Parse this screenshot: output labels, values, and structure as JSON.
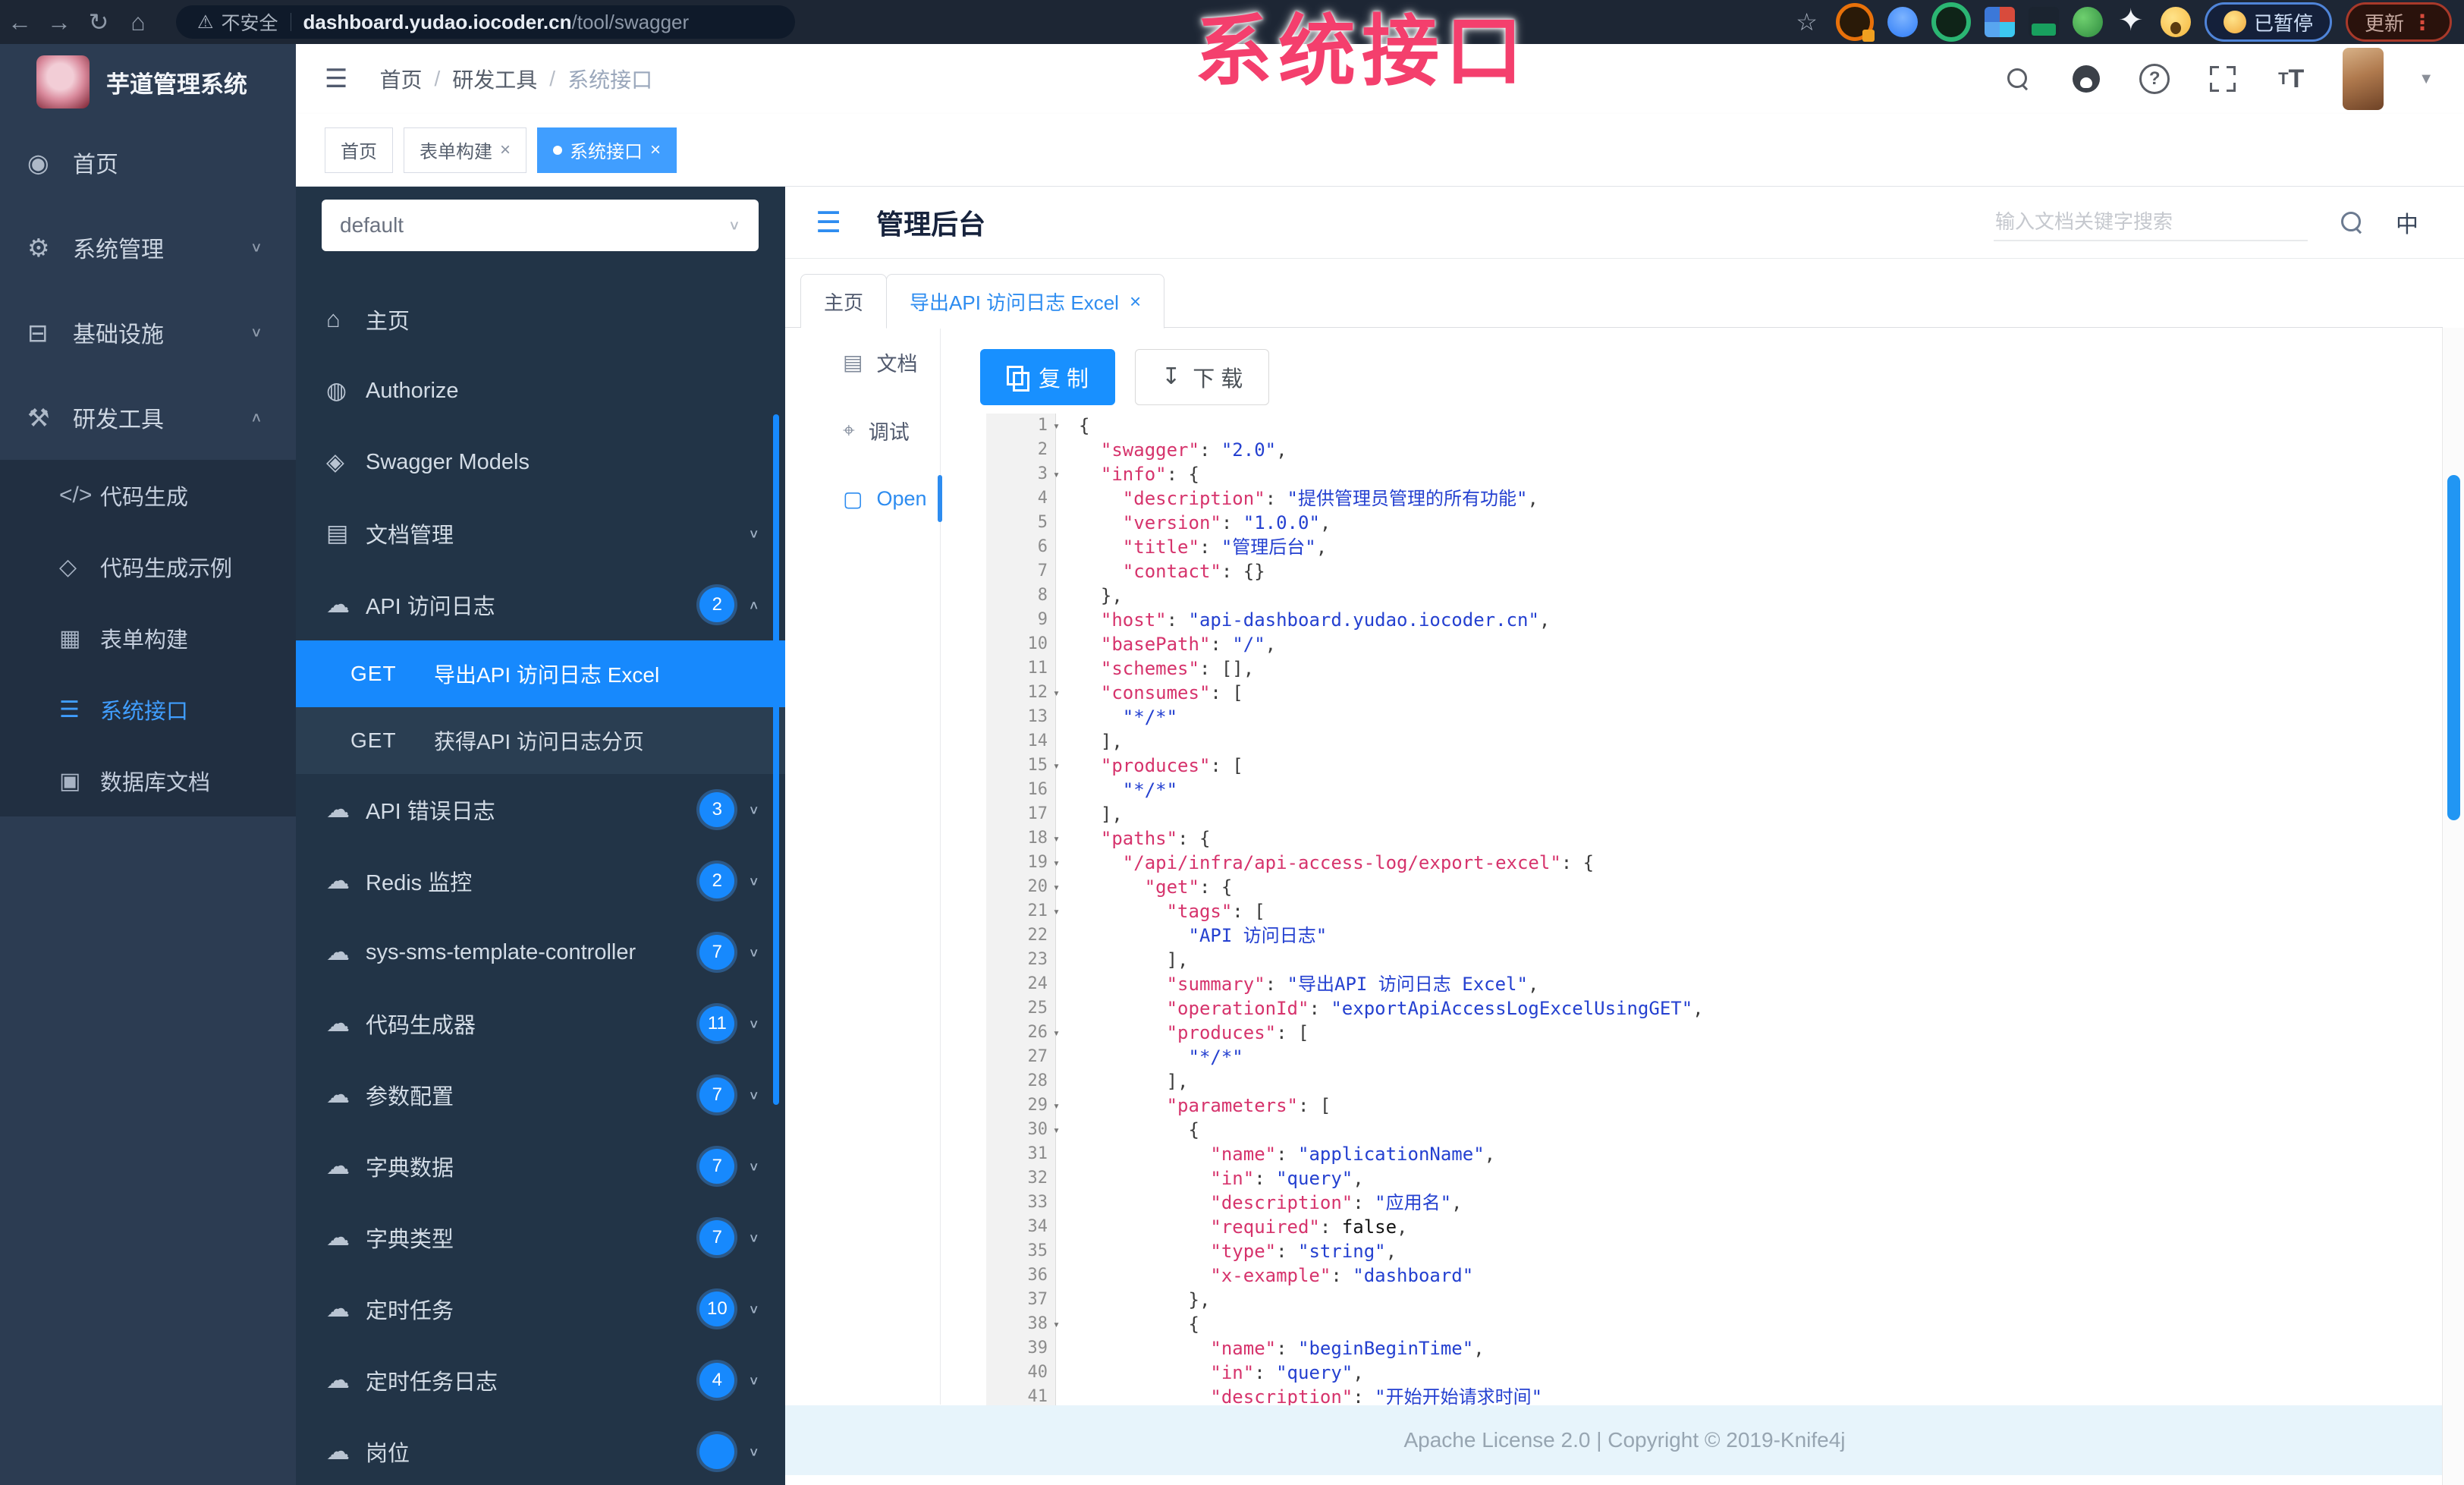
{
  "watermark": "系统接口",
  "browser": {
    "security_label": "不安全",
    "url_host": "dashboard.yudao.iocoder.cn",
    "url_path": "/tool/swagger",
    "nav_icons": [
      "back-icon",
      "forward-icon",
      "reload-icon",
      "home-icon"
    ],
    "nav_glyphs": [
      "←",
      "→",
      "↻",
      "⌂"
    ],
    "extensions": [
      "orange-extension-icon",
      "blue-drop-extension-icon",
      "green-ring-extension-icon",
      "grid-extension-icon",
      "dark-bottle-extension-icon",
      "green-leaf-extension-icon",
      "white-star-extension-icon",
      "emoji-extension-icon"
    ],
    "paused_label": "已暂停",
    "update_label": "更新"
  },
  "sidebar": {
    "logo_title": "芋道管理系统",
    "items": [
      {
        "label": "首页",
        "icon": "dashboard-icon",
        "glyph": "◉",
        "chevron": ""
      },
      {
        "label": "系统管理",
        "icon": "gear-icon",
        "glyph": "⚙",
        "chevron": "down"
      },
      {
        "label": "基础设施",
        "icon": "infrastructure-icon",
        "glyph": "⊟",
        "chevron": "down"
      },
      {
        "label": "研发工具",
        "icon": "tools-icon",
        "glyph": "⚒",
        "chevron": "up"
      }
    ],
    "submenu": [
      {
        "label": "代码生成",
        "icon": "code-icon",
        "glyph": "</>",
        "active": false
      },
      {
        "label": "代码生成示例",
        "icon": "code-example-icon",
        "glyph": "◇",
        "active": false
      },
      {
        "label": "表单构建",
        "icon": "form-builder-icon",
        "glyph": "▦",
        "active": false
      },
      {
        "label": "系统接口",
        "icon": "api-icon",
        "glyph": "☰",
        "active": true
      },
      {
        "label": "数据库文档",
        "icon": "database-icon",
        "glyph": "▣",
        "active": false
      }
    ]
  },
  "topnav": {
    "breadcrumb": [
      "首页",
      "研发工具",
      "系统接口"
    ]
  },
  "tags": [
    {
      "label": "首页",
      "closable": false,
      "active": false
    },
    {
      "label": "表单构建",
      "closable": true,
      "active": false
    },
    {
      "label": "系统接口",
      "closable": true,
      "active": true
    }
  ],
  "swagger_panel": {
    "group_select_value": "default",
    "items": [
      {
        "type": "link",
        "label": "主页",
        "icon": "home-icon",
        "glyph": "⌂"
      },
      {
        "type": "link",
        "label": "Authorize",
        "icon": "lock-icon",
        "glyph": "◍"
      },
      {
        "type": "link",
        "label": "Swagger Models",
        "icon": "models-icon",
        "glyph": "◈"
      },
      {
        "type": "group",
        "label": "文档管理",
        "icon": "document-icon",
        "glyph": "▤",
        "badge": "",
        "chevron": "down"
      },
      {
        "type": "group",
        "label": "API 访问日志",
        "icon": "cloud-icon",
        "glyph": "☁",
        "badge": "2",
        "chevron": "up"
      },
      {
        "type": "endpoint",
        "method": "GET",
        "label": "导出API 访问日志 Excel",
        "active": true
      },
      {
        "type": "endpoint",
        "method": "GET",
        "label": "获得API 访问日志分页",
        "active": false
      },
      {
        "type": "group",
        "label": "API 错误日志",
        "icon": "cloud-icon",
        "glyph": "☁",
        "badge": "3",
        "chevron": "down"
      },
      {
        "type": "group",
        "label": "Redis 监控",
        "icon": "cloud-icon",
        "glyph": "☁",
        "badge": "2",
        "chevron": "down"
      },
      {
        "type": "group",
        "label": "sys-sms-template-controller",
        "icon": "cloud-icon",
        "glyph": "☁",
        "badge": "7",
        "chevron": "down"
      },
      {
        "type": "group",
        "label": "代码生成器",
        "icon": "cloud-icon",
        "glyph": "☁",
        "badge": "11",
        "chevron": "down"
      },
      {
        "type": "group",
        "label": "参数配置",
        "icon": "cloud-icon",
        "glyph": "☁",
        "badge": "7",
        "chevron": "down"
      },
      {
        "type": "group",
        "label": "字典数据",
        "icon": "cloud-icon",
        "glyph": "☁",
        "badge": "7",
        "chevron": "down"
      },
      {
        "type": "group",
        "label": "字典类型",
        "icon": "cloud-icon",
        "glyph": "☁",
        "badge": "7",
        "chevron": "down"
      },
      {
        "type": "group",
        "label": "定时任务",
        "icon": "cloud-icon",
        "glyph": "☁",
        "badge": "10",
        "chevron": "down"
      },
      {
        "type": "group",
        "label": "定时任务日志",
        "icon": "cloud-icon",
        "glyph": "☁",
        "badge": "4",
        "chevron": "down"
      },
      {
        "type": "group",
        "label": "岗位",
        "icon": "cloud-icon",
        "glyph": "☁",
        "badge": "",
        "chevron": "down"
      }
    ]
  },
  "content": {
    "title": "管理后台",
    "search_placeholder": "输入文档关键字搜索",
    "lang_toggle": "中",
    "tabs": [
      {
        "label": "主页",
        "closable": false,
        "active": false
      },
      {
        "label": "导出API 访问日志 Excel",
        "closable": true,
        "active": true
      }
    ],
    "side_tabs": [
      {
        "label": "文档",
        "icon": "document-icon",
        "glyph": "▤",
        "active": false
      },
      {
        "label": "调试",
        "icon": "debug-icon",
        "glyph": "⌖",
        "active": false
      },
      {
        "label": "Open",
        "icon": "file-icon",
        "glyph": "▢",
        "active": true
      }
    ],
    "copy_label": "复 制",
    "download_label": "下 载",
    "footer": "Apache License 2.0 | Copyright © 2019-Knife4j"
  },
  "code": {
    "lines": [
      {
        "n": 1,
        "fold": true,
        "t": [
          [
            "p",
            "{"
          ]
        ]
      },
      {
        "n": 2,
        "fold": false,
        "t": [
          [
            "p",
            "  "
          ],
          [
            "k",
            "\"swagger\""
          ],
          [
            "p",
            ": "
          ],
          [
            "s",
            "\"2.0\""
          ],
          [
            "p",
            ","
          ]
        ]
      },
      {
        "n": 3,
        "fold": true,
        "t": [
          [
            "p",
            "  "
          ],
          [
            "k",
            "\"info\""
          ],
          [
            "p",
            ": {"
          ]
        ]
      },
      {
        "n": 4,
        "fold": false,
        "t": [
          [
            "p",
            "    "
          ],
          [
            "k",
            "\"description\""
          ],
          [
            "p",
            ": "
          ],
          [
            "s",
            "\"提供管理员管理的所有功能\""
          ],
          [
            "p",
            ","
          ]
        ]
      },
      {
        "n": 5,
        "fold": false,
        "t": [
          [
            "p",
            "    "
          ],
          [
            "k",
            "\"version\""
          ],
          [
            "p",
            ": "
          ],
          [
            "s",
            "\"1.0.0\""
          ],
          [
            "p",
            ","
          ]
        ]
      },
      {
        "n": 6,
        "fold": false,
        "t": [
          [
            "p",
            "    "
          ],
          [
            "k",
            "\"title\""
          ],
          [
            "p",
            ": "
          ],
          [
            "s",
            "\"管理后台\""
          ],
          [
            "p",
            ","
          ]
        ]
      },
      {
        "n": 7,
        "fold": false,
        "t": [
          [
            "p",
            "    "
          ],
          [
            "k",
            "\"contact\""
          ],
          [
            "p",
            ": {}"
          ]
        ]
      },
      {
        "n": 8,
        "fold": false,
        "t": [
          [
            "p",
            "  },"
          ]
        ]
      },
      {
        "n": 9,
        "fold": false,
        "t": [
          [
            "p",
            "  "
          ],
          [
            "k",
            "\"host\""
          ],
          [
            "p",
            ": "
          ],
          [
            "s",
            "\"api-dashboard.yudao.iocoder.cn\""
          ],
          [
            "p",
            ","
          ]
        ]
      },
      {
        "n": 10,
        "fold": false,
        "t": [
          [
            "p",
            "  "
          ],
          [
            "k",
            "\"basePath\""
          ],
          [
            "p",
            ": "
          ],
          [
            "s",
            "\"/\""
          ],
          [
            "p",
            ","
          ]
        ]
      },
      {
        "n": 11,
        "fold": false,
        "t": [
          [
            "p",
            "  "
          ],
          [
            "k",
            "\"schemes\""
          ],
          [
            "p",
            ": [],"
          ]
        ]
      },
      {
        "n": 12,
        "fold": true,
        "t": [
          [
            "p",
            "  "
          ],
          [
            "k",
            "\"consumes\""
          ],
          [
            "p",
            ": ["
          ]
        ]
      },
      {
        "n": 13,
        "fold": false,
        "t": [
          [
            "p",
            "    "
          ],
          [
            "s",
            "\"*/*\""
          ]
        ]
      },
      {
        "n": 14,
        "fold": false,
        "t": [
          [
            "p",
            "  ],"
          ]
        ]
      },
      {
        "n": 15,
        "fold": true,
        "t": [
          [
            "p",
            "  "
          ],
          [
            "k",
            "\"produces\""
          ],
          [
            "p",
            ": ["
          ]
        ]
      },
      {
        "n": 16,
        "fold": false,
        "t": [
          [
            "p",
            "    "
          ],
          [
            "s",
            "\"*/*\""
          ]
        ]
      },
      {
        "n": 17,
        "fold": false,
        "t": [
          [
            "p",
            "  ],"
          ]
        ]
      },
      {
        "n": 18,
        "fold": true,
        "t": [
          [
            "p",
            "  "
          ],
          [
            "k",
            "\"paths\""
          ],
          [
            "p",
            ": {"
          ]
        ]
      },
      {
        "n": 19,
        "fold": true,
        "t": [
          [
            "p",
            "    "
          ],
          [
            "k",
            "\"/api/infra/api-access-log/export-excel\""
          ],
          [
            "p",
            ": {"
          ]
        ]
      },
      {
        "n": 20,
        "fold": true,
        "t": [
          [
            "p",
            "      "
          ],
          [
            "k",
            "\"get\""
          ],
          [
            "p",
            ": {"
          ]
        ]
      },
      {
        "n": 21,
        "fold": true,
        "t": [
          [
            "p",
            "        "
          ],
          [
            "k",
            "\"tags\""
          ],
          [
            "p",
            ": ["
          ]
        ]
      },
      {
        "n": 22,
        "fold": false,
        "t": [
          [
            "p",
            "          "
          ],
          [
            "s",
            "\"API 访问日志\""
          ]
        ]
      },
      {
        "n": 23,
        "fold": false,
        "t": [
          [
            "p",
            "        ],"
          ]
        ]
      },
      {
        "n": 24,
        "fold": false,
        "t": [
          [
            "p",
            "        "
          ],
          [
            "k",
            "\"summary\""
          ],
          [
            "p",
            ": "
          ],
          [
            "s",
            "\"导出API 访问日志 Excel\""
          ],
          [
            "p",
            ","
          ]
        ]
      },
      {
        "n": 25,
        "fold": false,
        "t": [
          [
            "p",
            "        "
          ],
          [
            "k",
            "\"operationId\""
          ],
          [
            "p",
            ": "
          ],
          [
            "s",
            "\"exportApiAccessLogExcelUsingGET\""
          ],
          [
            "p",
            ","
          ]
        ]
      },
      {
        "n": 26,
        "fold": true,
        "t": [
          [
            "p",
            "        "
          ],
          [
            "k",
            "\"produces\""
          ],
          [
            "p",
            ": ["
          ]
        ]
      },
      {
        "n": 27,
        "fold": false,
        "t": [
          [
            "p",
            "          "
          ],
          [
            "s",
            "\"*/*\""
          ]
        ]
      },
      {
        "n": 28,
        "fold": false,
        "t": [
          [
            "p",
            "        ],"
          ]
        ]
      },
      {
        "n": 29,
        "fold": true,
        "t": [
          [
            "p",
            "        "
          ],
          [
            "k",
            "\"parameters\""
          ],
          [
            "p",
            ": ["
          ]
        ]
      },
      {
        "n": 30,
        "fold": true,
        "t": [
          [
            "p",
            "          {"
          ]
        ]
      },
      {
        "n": 31,
        "fold": false,
        "t": [
          [
            "p",
            "            "
          ],
          [
            "k",
            "\"name\""
          ],
          [
            "p",
            ": "
          ],
          [
            "s",
            "\"applicationName\""
          ],
          [
            "p",
            ","
          ]
        ]
      },
      {
        "n": 32,
        "fold": false,
        "t": [
          [
            "p",
            "            "
          ],
          [
            "k",
            "\"in\""
          ],
          [
            "p",
            ": "
          ],
          [
            "s",
            "\"query\""
          ],
          [
            "p",
            ","
          ]
        ]
      },
      {
        "n": 33,
        "fold": false,
        "t": [
          [
            "p",
            "            "
          ],
          [
            "k",
            "\"description\""
          ],
          [
            "p",
            ": "
          ],
          [
            "s",
            "\"应用名\""
          ],
          [
            "p",
            ","
          ]
        ]
      },
      {
        "n": 34,
        "fold": false,
        "t": [
          [
            "p",
            "            "
          ],
          [
            "k",
            "\"required\""
          ],
          [
            "p",
            ": "
          ],
          [
            "b",
            "false"
          ],
          [
            "p",
            ","
          ]
        ]
      },
      {
        "n": 35,
        "fold": false,
        "t": [
          [
            "p",
            "            "
          ],
          [
            "k",
            "\"type\""
          ],
          [
            "p",
            ": "
          ],
          [
            "s",
            "\"string\""
          ],
          [
            "p",
            ","
          ]
        ]
      },
      {
        "n": 36,
        "fold": false,
        "t": [
          [
            "p",
            "            "
          ],
          [
            "k",
            "\"x-example\""
          ],
          [
            "p",
            ": "
          ],
          [
            "s",
            "\"dashboard\""
          ]
        ]
      },
      {
        "n": 37,
        "fold": false,
        "t": [
          [
            "p",
            "          },"
          ]
        ]
      },
      {
        "n": 38,
        "fold": true,
        "t": [
          [
            "p",
            "          {"
          ]
        ]
      },
      {
        "n": 39,
        "fold": false,
        "t": [
          [
            "p",
            "            "
          ],
          [
            "k",
            "\"name\""
          ],
          [
            "p",
            ": "
          ],
          [
            "s",
            "\"beginBeginTime\""
          ],
          [
            "p",
            ","
          ]
        ]
      },
      {
        "n": 40,
        "fold": false,
        "t": [
          [
            "p",
            "            "
          ],
          [
            "k",
            "\"in\""
          ],
          [
            "p",
            ": "
          ],
          [
            "s",
            "\"query\""
          ],
          [
            "p",
            ","
          ]
        ]
      },
      {
        "n": 41,
        "fold": false,
        "t": [
          [
            "p",
            "            "
          ],
          [
            "k",
            "\"description\""
          ],
          [
            "p",
            ": "
          ],
          [
            "s",
            "\"开始开始请求时间\""
          ]
        ]
      }
    ]
  }
}
